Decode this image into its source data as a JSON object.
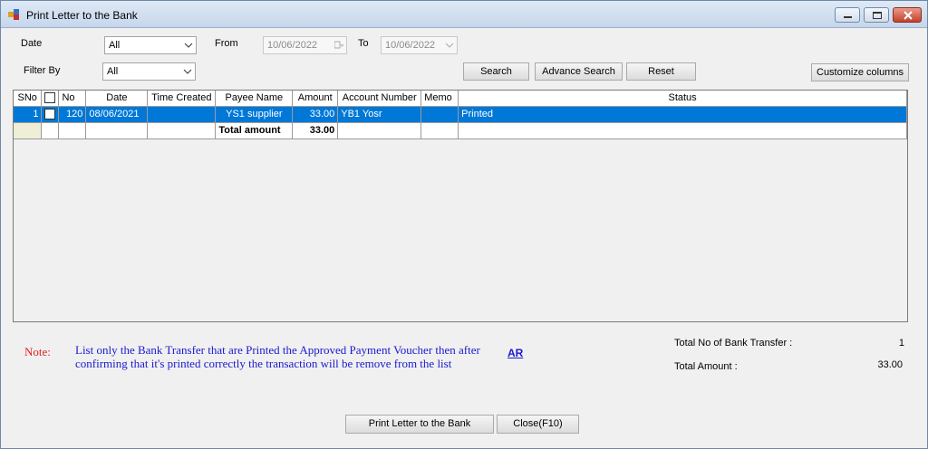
{
  "window": {
    "title": "Print Letter to the Bank"
  },
  "filters": {
    "date_label": "Date",
    "date_value": "All",
    "from_label": "From",
    "from_value": "10/06/2022",
    "to_label": "To",
    "to_value": "10/06/2022",
    "filter_by_label": "Filter By",
    "filter_by_value": "All"
  },
  "buttons": {
    "search": "Search",
    "advance_search": "Advance Search",
    "reset": "Reset",
    "customize_columns": "Customize columns",
    "print_letter": "Print Letter to the Bank",
    "close": "Close(F10)"
  },
  "grid": {
    "columns": [
      "SNo",
      "",
      "No",
      "Date",
      "Time Created",
      "Payee Name",
      "Amount",
      "Account Number",
      "Memo",
      "Status"
    ],
    "rows": [
      {
        "sno": "1",
        "no": "120",
        "date": "08/06/2021",
        "time_created": "",
        "payee": "YS1 supplier",
        "amount": "33.00",
        "account": "YB1 Yosr",
        "memo": "",
        "status": "Printed"
      }
    ],
    "total_label": "Total amount",
    "total_value": "33.00"
  },
  "note": {
    "label": "Note:",
    "text": "List only the Bank Transfer that are Printed the Approved Payment Voucher then after confirming that it's printed correctly the transaction will be remove from the list",
    "link": "AR"
  },
  "summary": {
    "count_label": "Total No of Bank Transfer :",
    "count_value": "1",
    "amount_label": "Total Amount :",
    "amount_value": "33.00"
  },
  "colors": {
    "selection": "#0078d7",
    "note_label": "#e0201a",
    "note_text": "#1a1ad0"
  }
}
